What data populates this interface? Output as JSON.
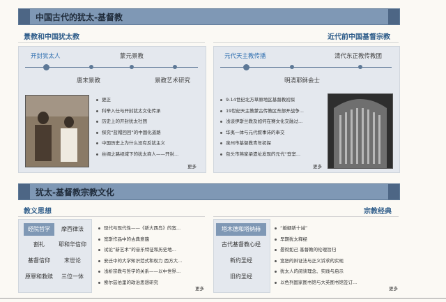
{
  "banner1": {
    "title": "中国古代的犹太-基督教"
  },
  "banner2": {
    "title": "犹太-基督教宗教文化"
  },
  "left1": {
    "heading": "景教和中国犹太教",
    "timeline_top": [
      "开封犹太人",
      "蒙元景教"
    ],
    "timeline_bottom": [
      "唐末景教",
      "景教艺术研究"
    ],
    "news": [
      "更正",
      "科举入仕与开封犹太文化传承",
      "历史上的开封犹太社团",
      "探究“蓝帽回回”的中国化道路",
      "中国历史上为什么没有反犹主义",
      "丝绸之路视域下的犹太商人——开封..."
    ],
    "more": "更多"
  },
  "right1": {
    "heading": "近代前中国基督宗教",
    "timeline_top": [
      "元代天主教传播",
      "清代东正教传教团"
    ],
    "timeline_bottom": [
      "明清耶稣会士"
    ],
    "news": [
      "9-14世纪北方草原地区基督教初探",
      "19世纪天主教蒙古传教区东部开战争...",
      "浅谈伊斯兰教及如何在赛文化交融过...",
      "华夷一体与元代叙事诗的奉交",
      "泉州市基督教青年初探",
      "包头市燕家梁遗址发现的元代“登室..."
    ],
    "more": "更多"
  },
  "left2": {
    "heading": "教义思想",
    "grid": [
      [
        "经院哲学",
        "摩西律法"
      ],
      [
        "割礼",
        "耶和华信仰"
      ],
      [
        "基督信仰",
        "末世论"
      ],
      [
        "原罪和救赎",
        "三位一体"
      ]
    ],
    "news": [
      "现代与现代性——《新大西岛》的宽...",
      "宽斯作品中的古典意蕴",
      "试论“新艺术”的音乐特征和历史地...",
      "安迁中的大学知识范式和权力 西方大...",
      "浅析宗教与哲学的关系——以中世界...",
      "索尔兹伯里的政治思想研究"
    ],
    "more": "更多"
  },
  "right2": {
    "heading": "宗教经典",
    "column": [
      "塔木德和塔纳赫",
      "古代基督教心经",
      "新约圣经",
      "旧约圣经"
    ],
    "news": [
      "“婚姻新十诫”",
      "早期犹太释经",
      "晏彻如己 基督教的伦理旨归",
      "宽恕的辩证法与正义诉求的实现",
      "犹太人的阅读理念、实践与启示",
      "以色列国家图书馆与大英图书馆签订..."
    ],
    "more": "更多"
  },
  "colors": {
    "accent": "#7f98b5",
    "heading": "#2f5d8a",
    "panel": "#e4e8ee"
  }
}
